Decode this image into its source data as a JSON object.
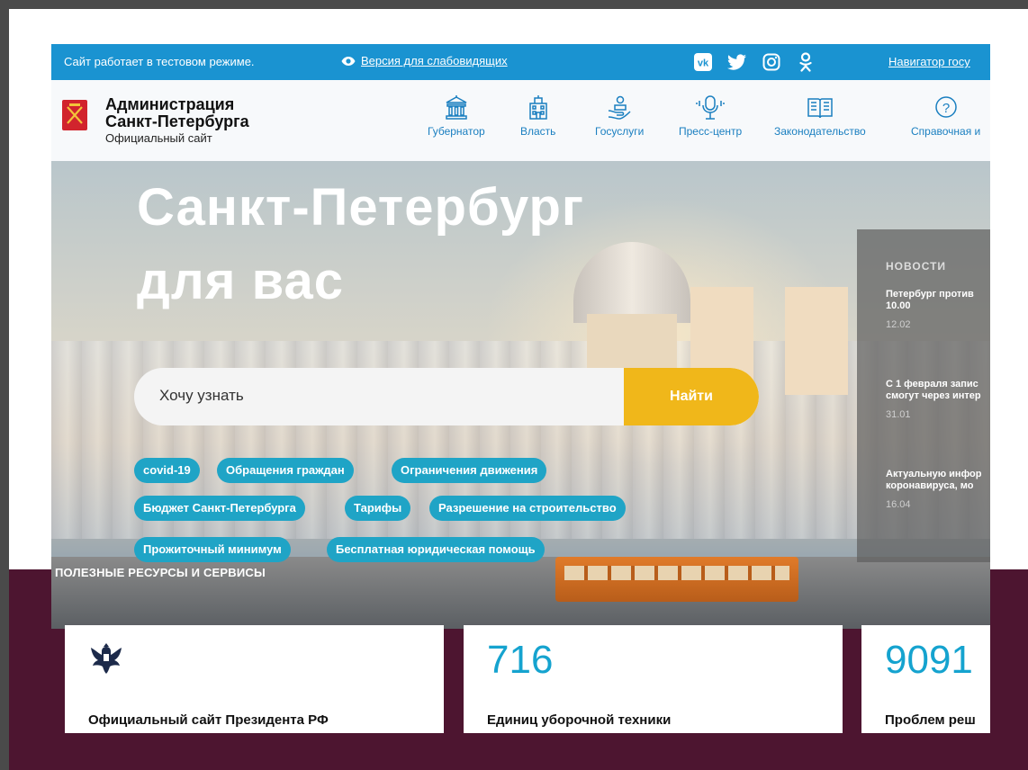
{
  "topbar": {
    "test_mode": "Сайт работает в тестовом режиме.",
    "vision_link": "Версия для слабовидящих",
    "navigator": "Навигатор госу",
    "social_icons": [
      "vk-icon",
      "twitter-icon",
      "instagram-icon",
      "odnoklassniki-icon"
    ]
  },
  "header": {
    "org_line1": "Администрация",
    "org_line2": "Санкт-Петербурга",
    "subtitle": "Официальный сайт",
    "nav": [
      {
        "label": "Губернатор",
        "icon": "governor-building-icon"
      },
      {
        "label": "Власть",
        "icon": "power-building-icon"
      },
      {
        "label": "Госуслуги",
        "icon": "services-hand-icon"
      },
      {
        "label": "Пресс-центр",
        "icon": "microphone-icon"
      },
      {
        "label": "Законодательство",
        "icon": "law-book-icon"
      },
      {
        "label": "Справочная и",
        "icon": "help-question-icon"
      }
    ]
  },
  "hero": {
    "title_line1": "Санкт-Петербург",
    "title_line2": "для вас",
    "search_placeholder": "Хочу узнать",
    "search_button": "Найти",
    "tags": [
      "covid-19",
      "Обращения граждан",
      "Ограничения движения",
      "Бюджет Санкт-Петербурга",
      "Тарифы",
      "Разрешение на строительство",
      "Прожиточный минимум",
      "Бесплатная юридическая помощь"
    ]
  },
  "news": {
    "title": "НОВОСТИ",
    "items": [
      {
        "line1": "Петербург против",
        "line2": "10.00",
        "date": "12.02"
      },
      {
        "line1": "С 1 февраля запис",
        "line2": "смогут через интер",
        "date": "31.01"
      },
      {
        "line1": "Актуальную инфор",
        "line2": "коронавируса, мо",
        "date": "16.04"
      }
    ]
  },
  "resources": {
    "label": "ПОЛЕЗНЫЕ РЕСУРСЫ И СЕРВИСЫ",
    "cards": [
      {
        "value": "",
        "label": "Официальный сайт Президента РФ"
      },
      {
        "value": "716",
        "label": "Единиц уборочной техники"
      },
      {
        "value": "9091",
        "label": "Проблем реш"
      }
    ]
  },
  "colors": {
    "topbar": "#1a93d1",
    "accent_button": "#f0b71a",
    "tag": "#1fa4c6",
    "nav_text": "#1a7fc0",
    "maroon_band": "#4d1530"
  }
}
